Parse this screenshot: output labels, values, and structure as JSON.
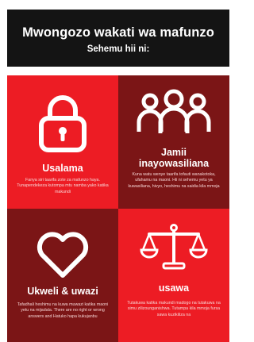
{
  "header": {
    "title": "Mwongozo wakati wa mafunzo",
    "subtitle": "Sehemu hii ni:"
  },
  "panels": [
    {
      "icon": "lock-icon",
      "title": "Usalama",
      "description": "Fanya siri taarifa zote za mafunzo haya. Tunapendekeza kutompa mtu namba yako katika makundi"
    },
    {
      "icon": "people-icon",
      "title_line1": "Jamii",
      "title_line2": "inayowasiliana",
      "description": "Kuna watu wenye taarifa tofauti wanakotoka, ufahamu na maoni. Hii ni sehemu yetu ya kuwasiliana, hivyo, heshimu na saidia kila mmoja"
    },
    {
      "icon": "heart-icon",
      "title": "Ukweli & uwazi",
      "description": "Tafadhali heshimu na kuwa muwazi katika maoni yetu na mijadala. There are no right or wrong answers and Hatuko hapa kukujanbu"
    },
    {
      "icon": "scales-icon",
      "title": "usawa",
      "description": "Tutakuwa katika makundi madogo na tutakuwa na simu zilizounganishwa. Tutampa kila mmoja fursa sawa kuzikiliza na"
    }
  ],
  "colors": {
    "header": "#141414",
    "red": "#ed1c24",
    "dark_red": "#7b1516"
  }
}
